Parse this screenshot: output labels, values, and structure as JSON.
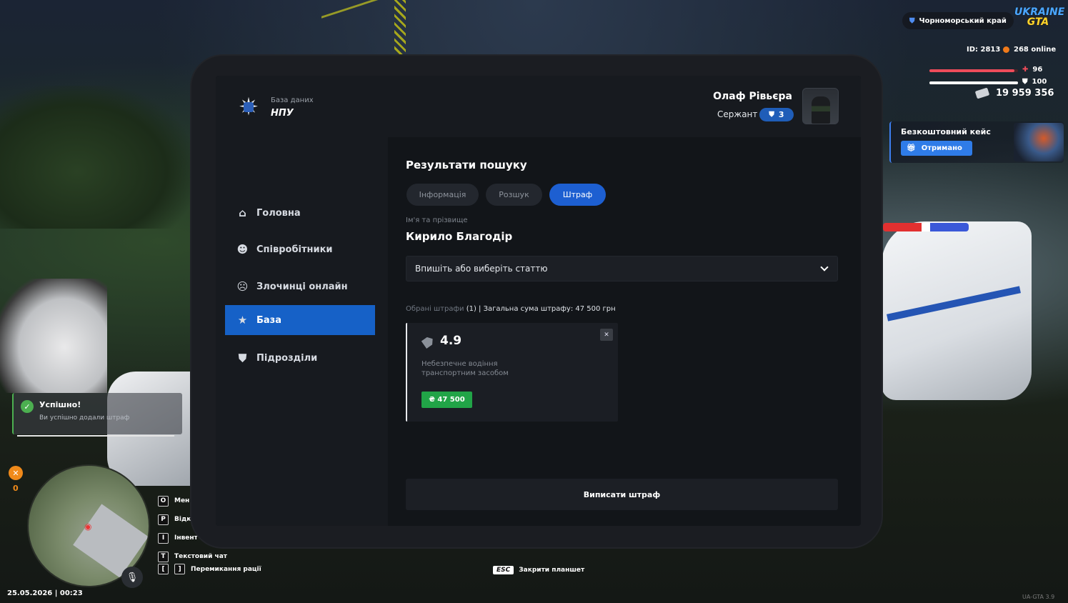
{
  "hud": {
    "region": "Чорноморський край",
    "logo_line1": "UKRAINE",
    "logo_line2": "GTA",
    "player_id": "ID: 2813",
    "online": "268 online",
    "health": "96",
    "health_fraction": 0.96,
    "armor": "100",
    "armor_fraction": 1.0,
    "money": "19 959 356",
    "free_case_title": "Безкоштовний кейс",
    "free_case_button": "Отримано",
    "hunger": "0",
    "datetime": "25.05.2026 | 00:23",
    "version": "UA-GTA 3.9",
    "esc_key": "ESC",
    "esc_label": "Закрити планшет",
    "hints": [
      {
        "key": "O",
        "label": "Мен"
      },
      {
        "key": "P",
        "label": "Відк"
      },
      {
        "key": "I",
        "label": "Інвент"
      },
      {
        "key": "T",
        "label": "Текстовий чат"
      }
    ],
    "hint_race_keys": [
      "[",
      "]"
    ],
    "hint_race_label": "Перемикання рації"
  },
  "notification": {
    "title": "Успішно!",
    "message": "Ви успішно додали штраф"
  },
  "tablet": {
    "brand_subtitle": "База даних",
    "brand_title": "НПУ",
    "nav": [
      {
        "label": "Головна",
        "icon": "home-icon"
      },
      {
        "label": "Співробітники",
        "icon": "people-icon"
      },
      {
        "label": "Злочинці онлайн",
        "icon": "criminal-mask-icon"
      },
      {
        "label": "База",
        "icon": "star-icon",
        "active": true
      },
      {
        "label": "Підрозділи",
        "icon": "shield-icon"
      }
    ],
    "user_name": "Олаф Рівьєра",
    "user_rank": "Сержант",
    "user_rank_level": "3",
    "section_title": "Результати пошуку",
    "tabs": [
      {
        "label": "Інформація",
        "active": false
      },
      {
        "label": "Розшук",
        "active": false
      },
      {
        "label": "Штраф",
        "active": true
      }
    ],
    "name_label": "Ім'я та прізвище",
    "person_name": "Кирило Благодір",
    "article_placeholder": "Впишіть або виберіть статтю",
    "selected_prefix": "Обрані штрафи",
    "selected_count": "(1) | Загальна сума штрафу: 47 500 грн",
    "fine_card": {
      "article": "4.9",
      "description": "Небезпечне водіння транспортним засобом",
      "amount": "₴ 47 500"
    },
    "submit_button": "Виписати штраф"
  }
}
